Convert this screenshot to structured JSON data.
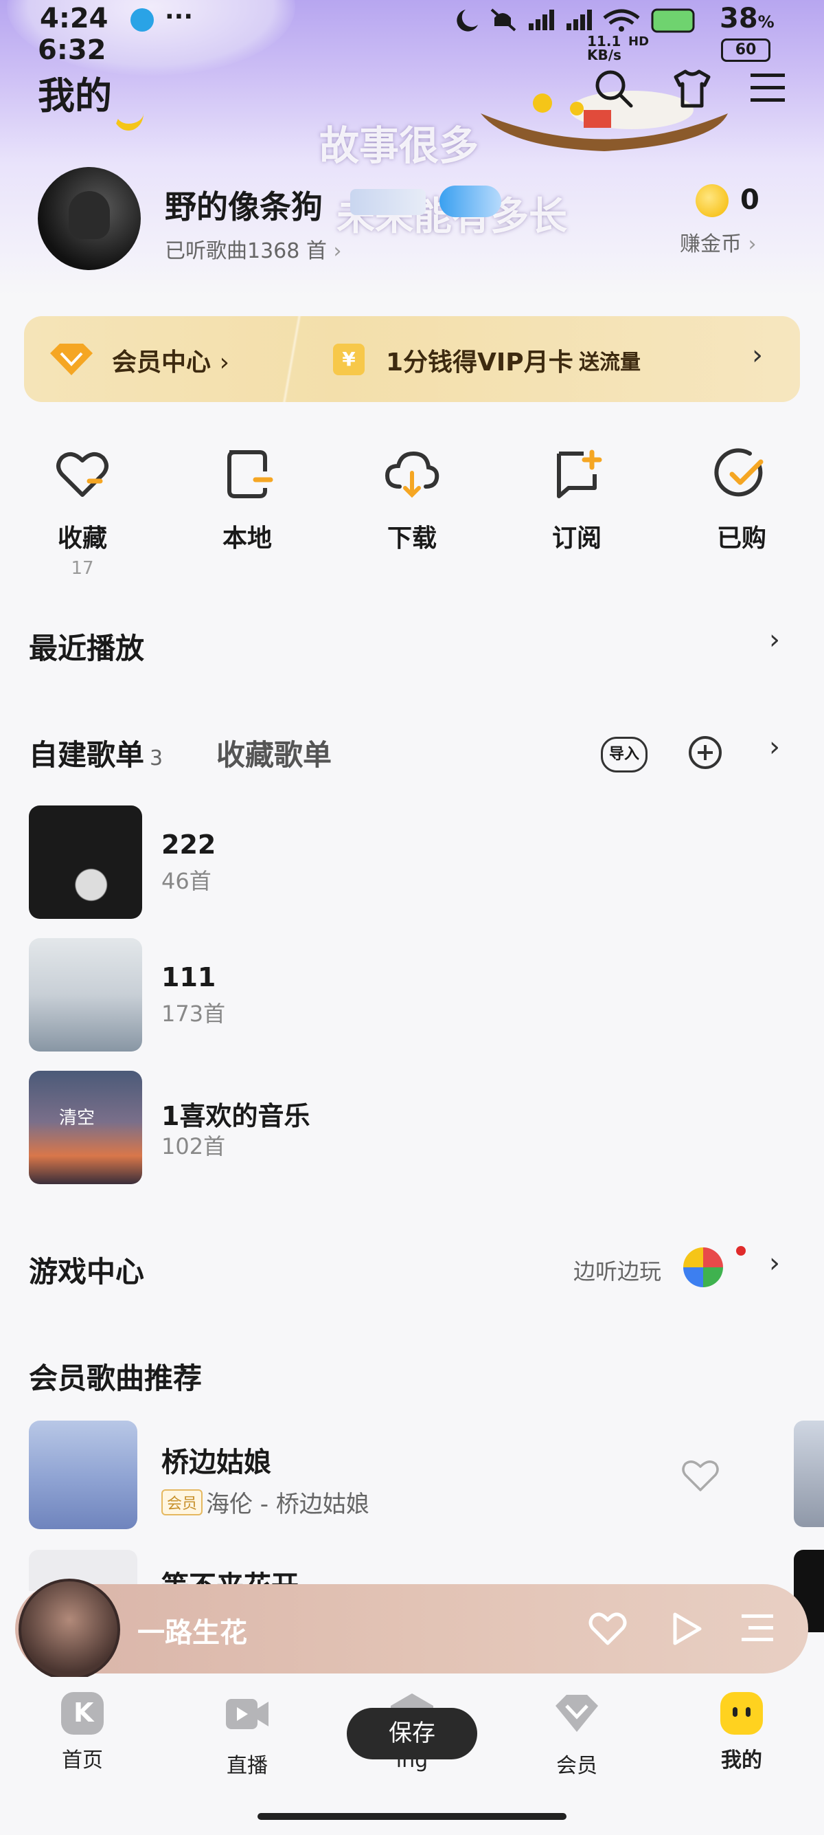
{
  "status": {
    "time_top": "4:24",
    "time_overlay": "6:32",
    "battery_pct": "38",
    "battery_pct_suffix": "%",
    "battery2": "60",
    "net_speed": "11.1 KB/s",
    "hd_label": "HD"
  },
  "header": {
    "title": "我的",
    "lyric_line1": "故事很多",
    "lyric_line2": "未来能有多长"
  },
  "profile": {
    "username": "野的像条狗",
    "listened": "已听歌曲1368 首",
    "coins": "0",
    "earn_coins": "赚金币"
  },
  "vip": {
    "member_center": "会员中心",
    "offer": "1分钱得VIP月卡",
    "offer_extra": "送流量"
  },
  "quick": [
    {
      "label": "收藏",
      "count": "17"
    },
    {
      "label": "本地",
      "count": ""
    },
    {
      "label": "下载",
      "count": ""
    },
    {
      "label": "订阅",
      "count": ""
    },
    {
      "label": "已购",
      "count": ""
    }
  ],
  "recent": {
    "title": "最近播放"
  },
  "playlists": {
    "tab_created": "自建歌单",
    "created_count": "3",
    "tab_collected": "收藏歌单",
    "import_label": "导入",
    "items": [
      {
        "name": "222",
        "count": "46首"
      },
      {
        "name": "111",
        "count": "173首"
      },
      {
        "name": "1喜欢的音乐",
        "count": "102首",
        "cover_text": "清空"
      }
    ]
  },
  "games": {
    "title": "游戏中心",
    "tagline": "边听边玩"
  },
  "recommend": {
    "title": "会员歌曲推荐",
    "items": [
      {
        "title": "桥边姑娘",
        "badge": "会员",
        "artist": "海伦 - 桥边姑娘"
      },
      {
        "title": "等不来花开"
      }
    ]
  },
  "player": {
    "song": "一路生花"
  },
  "tabs": [
    {
      "label": "首页"
    },
    {
      "label": "直播"
    },
    {
      "label": "ing"
    },
    {
      "label": "会员"
    },
    {
      "label": "我的"
    }
  ],
  "toast": "保存",
  "colors": {
    "accent": "#f5a623",
    "vip_gold": "#f3dfab",
    "active_tab": "#ffd21f"
  }
}
